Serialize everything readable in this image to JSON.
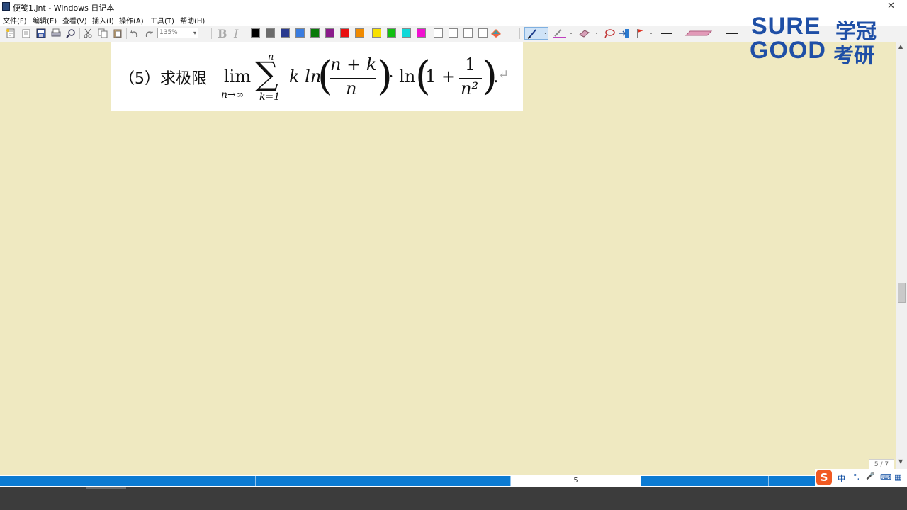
{
  "window": {
    "title": "便笺1.jnt - Windows 日记本",
    "close_glyph": "✕"
  },
  "menu": [
    "文件(F)",
    "编辑(E)",
    "查看(V)",
    "插入(I)",
    "操作(A)",
    "工具(T)",
    "帮助(H)"
  ],
  "toolbar": {
    "zoom_value": "135%",
    "bold_label": "B",
    "italic_label": "I",
    "icons": [
      "new-note-icon",
      "open-icon",
      "save-icon",
      "print-icon",
      "find-icon",
      "cut-icon",
      "copy-icon",
      "paste-icon",
      "undo-icon",
      "redo-icon"
    ],
    "pen_colors": [
      "#000000",
      "#6b6b6b",
      "#2a3a8f",
      "#3a7de0",
      "#0a7a0a",
      "#8a1a8a",
      "#e81010",
      "#f08a00",
      "#f7e000",
      "#12c012",
      "#10d8d8",
      "#f010d0",
      "#ffffff",
      "#ffffff",
      "#ffffff",
      "#ffffff"
    ],
    "tool_icons": [
      "pen-icon",
      "highlighter-icon",
      "eraser-icon",
      "lasso-select-icon",
      "insert-space-icon",
      "flag-icon",
      "pen-width-icon",
      "highlighter-style-icon"
    ]
  },
  "note": {
    "problem_label": "（5）求极限",
    "lim": "lim",
    "lim_sub": "n→∞",
    "sum_top": "n",
    "sum_sigma": "∑",
    "sum_bottom": "k=1",
    "k_ln": "k ln",
    "frac1_num": "n + k",
    "frac1_den": "n",
    "dot_ln": "· ln",
    "one_plus": "1 +",
    "frac2_num": "1",
    "frac2_den": "n²",
    "end": ".",
    "return_mark": "↵"
  },
  "watermark": {
    "line1": "SURE",
    "line2": "GOOD",
    "cn1": "学冠",
    "cn2": "考研"
  },
  "pager": {
    "current_page": "5",
    "page_indicator": "5 / 7"
  },
  "ime": {
    "logo": "S",
    "mode": "中",
    "punct": "°,",
    "mic": "🎤",
    "kbd": "⌨",
    "grid": "▦"
  }
}
